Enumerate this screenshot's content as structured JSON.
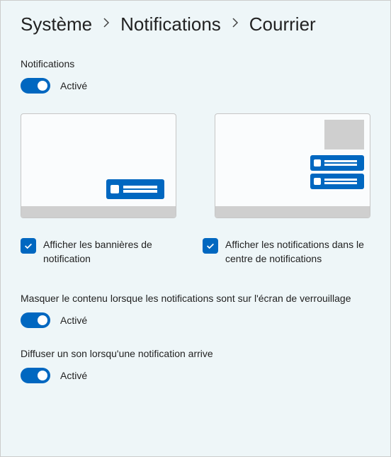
{
  "breadcrumb": {
    "root": "Système",
    "mid": "Notifications",
    "leaf": "Courrier"
  },
  "notifications": {
    "label": "Notifications",
    "toggle_state": "Activé"
  },
  "checkboxes": {
    "banners": "Afficher les bannières de notification",
    "center": "Afficher les notifications dans le centre de notifications"
  },
  "hide_content": {
    "label": "Masquer le contenu lorsque les notifications sont sur l'écran de verrouillage",
    "toggle_state": "Activé"
  },
  "play_sound": {
    "label": "Diffuser un son lorsqu'une notification arrive",
    "toggle_state": "Activé"
  }
}
